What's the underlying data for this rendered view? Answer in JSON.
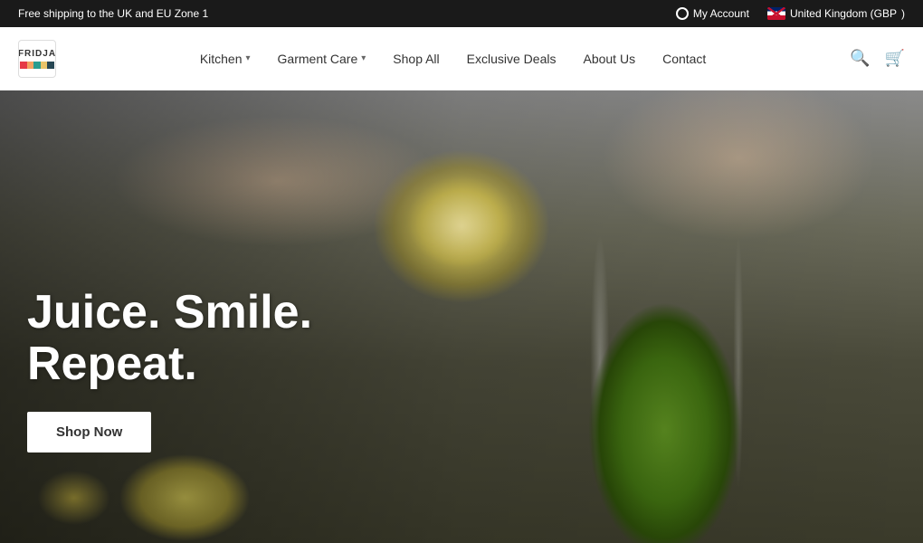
{
  "topbar": {
    "shipping_text": "Free shipping to the UK and EU Zone 1",
    "account_label": "My Account",
    "region_label": "United Kingdom (GBP"
  },
  "navbar": {
    "logo_text": "FRIDJA",
    "nav_items": [
      {
        "id": "kitchen",
        "label": "Kitchen",
        "has_dropdown": true
      },
      {
        "id": "garment-care",
        "label": "Garment Care",
        "has_dropdown": true
      },
      {
        "id": "shop-all",
        "label": "Shop All",
        "has_dropdown": false
      },
      {
        "id": "exclusive-deals",
        "label": "Exclusive Deals",
        "has_dropdown": false
      },
      {
        "id": "about-us",
        "label": "About Us",
        "has_dropdown": false
      },
      {
        "id": "contact",
        "label": "Contact",
        "has_dropdown": false
      }
    ],
    "search_label": "Search",
    "cart_label": "Cart"
  },
  "hero": {
    "title_line1": "Juice. Smile.",
    "title_line2": "Repeat.",
    "cta_label": "Shop Now"
  }
}
